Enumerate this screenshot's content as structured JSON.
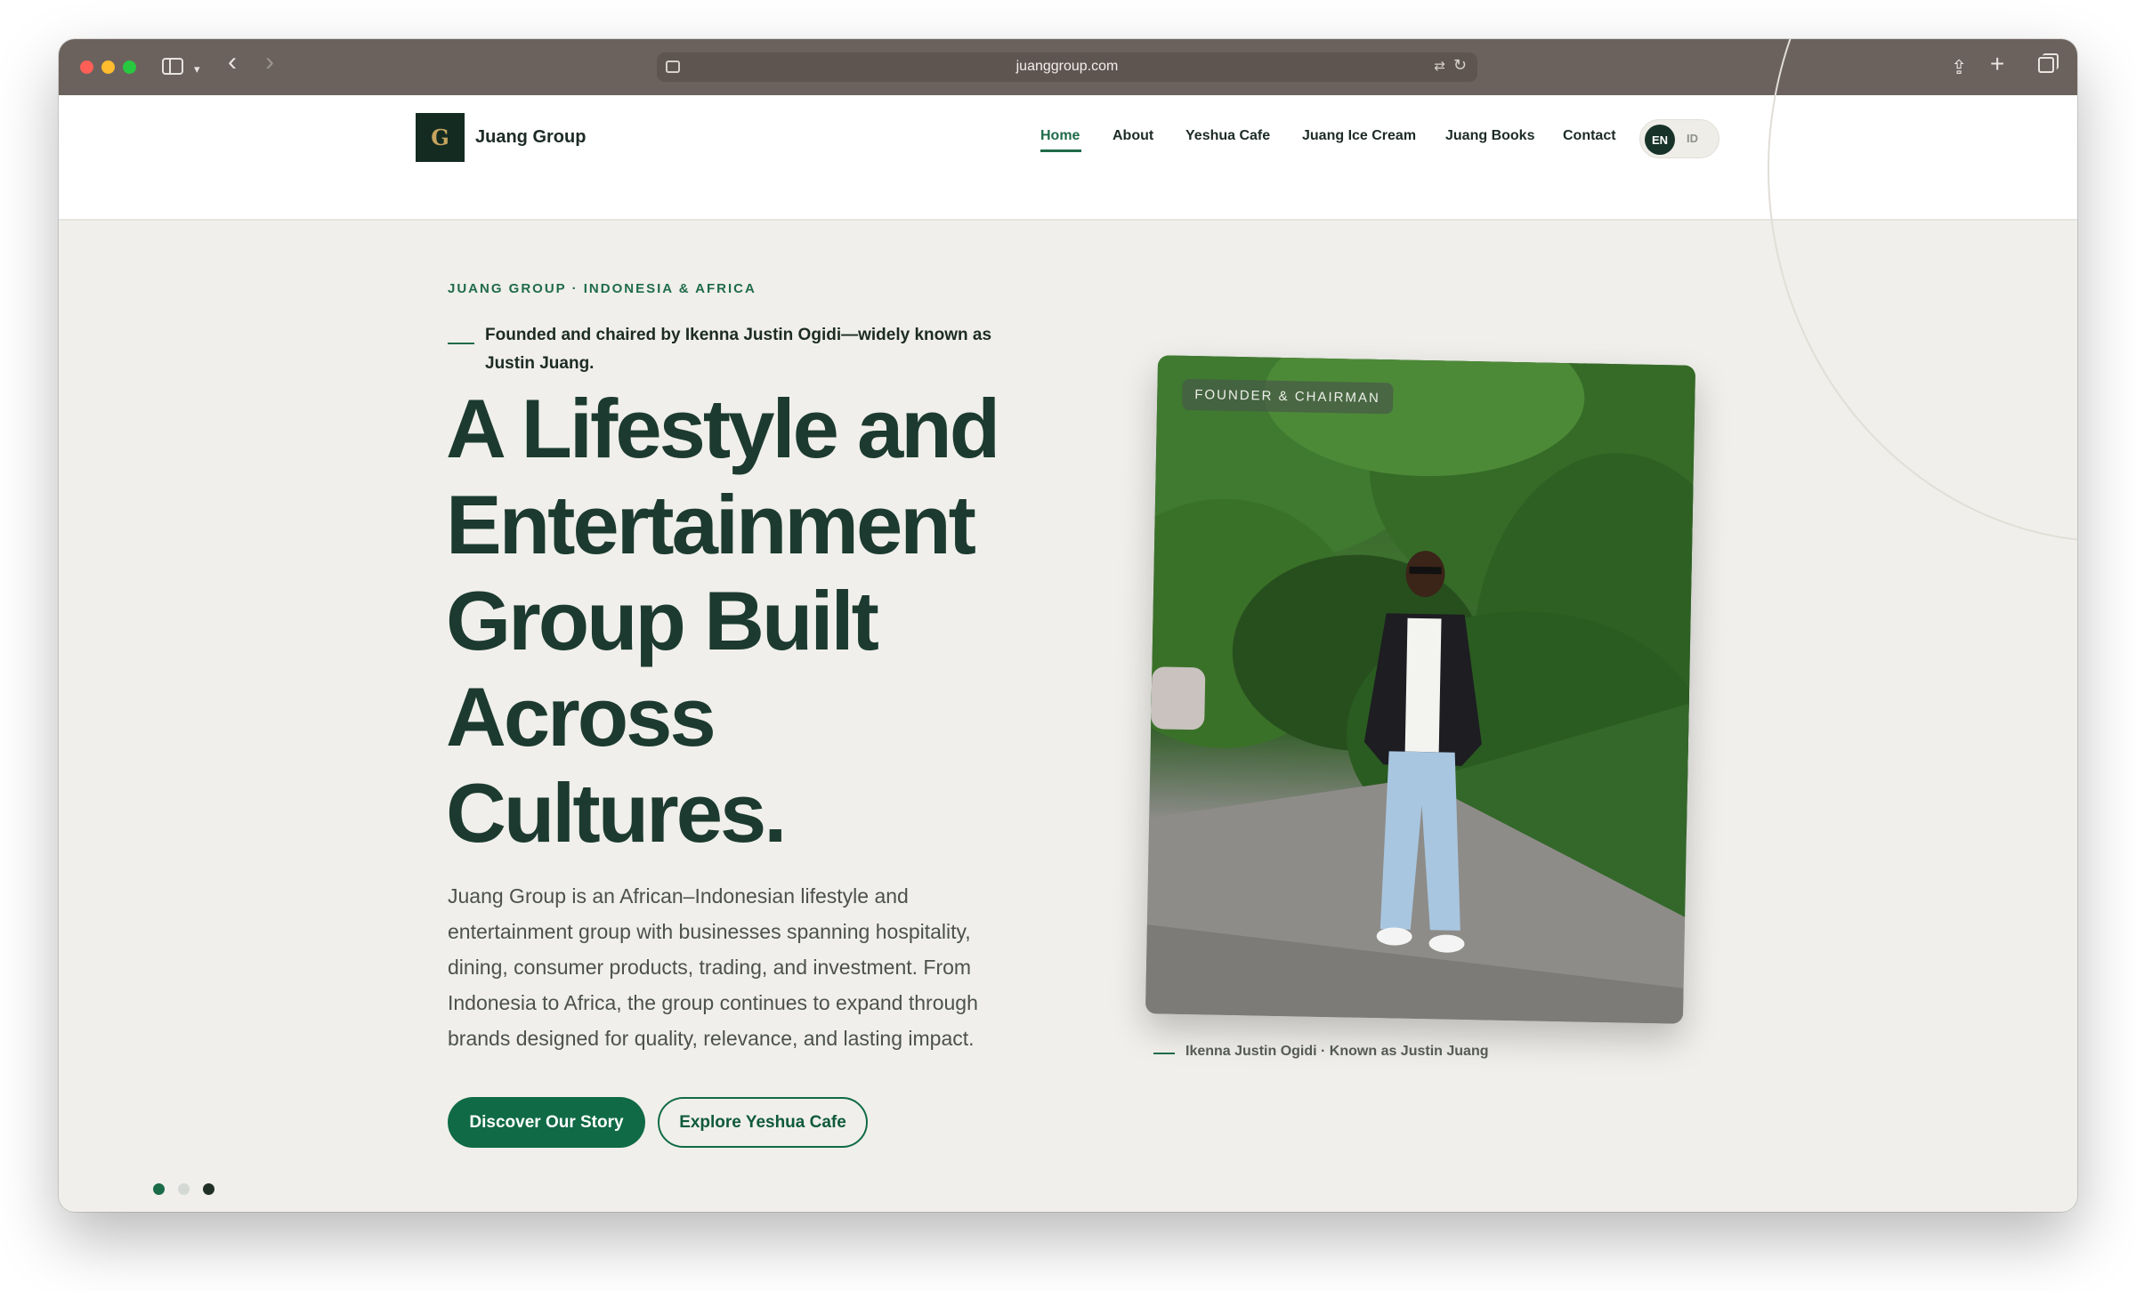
{
  "browser": {
    "url": "juanggroup.com"
  },
  "header": {
    "brand_name": "Juang Group",
    "nav": [
      {
        "label": "Home",
        "active": true
      },
      {
        "label": "About"
      },
      {
        "label": "Yeshua Cafe"
      },
      {
        "label": "Juang Ice Cream"
      },
      {
        "label": "Juang Books"
      },
      {
        "label": "Contact"
      }
    ],
    "lang": {
      "en": "EN",
      "id": "ID",
      "active": "EN"
    }
  },
  "hero": {
    "eyebrow": "JUANG GROUP · INDONESIA & AFRICA",
    "founder_line": "Founded and chaired by Ikenna Justin Ogidi—widely known as Justin Juang.",
    "title_lines": [
      "A Lifestyle and",
      "Entertainment",
      "Group Built",
      "Across",
      "Cultures."
    ],
    "description": "Juang Group is an African–Indonesian lifestyle and entertainment group with businesses spanning hospitality, dining, consumer products, trading, and investment. From Indonesia to Africa, the group continues to expand through brands designed for quality, relevance, and lasting impact.",
    "primary_button": "Discover Our Story",
    "secondary_button": "Explore Yeshua Cafe",
    "photo_badge": "FOUNDER & CHAIRMAN",
    "photo_caption": "Ikenna Justin Ogidi · Known as Justin Juang",
    "carousel": {
      "count": 3,
      "active_index": 0
    }
  },
  "colors": {
    "brand_green": "#0f6a45",
    "heading": "#1c3a30",
    "background": "#f0efeb"
  }
}
